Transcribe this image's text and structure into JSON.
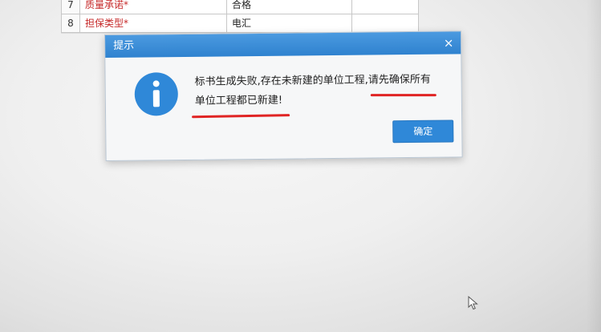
{
  "table": {
    "rows": [
      {
        "index": "7",
        "label": "质量承诺*",
        "value": "合格"
      },
      {
        "index": "8",
        "label": "担保类型*",
        "value": "电汇"
      }
    ]
  },
  "dialog": {
    "title": "提示",
    "close": "×",
    "message_line1": "标书生成失败,存在未新建的单位工程,请先确保所有",
    "message_line2": "单位工程都已新建!",
    "ok_label": "确定",
    "icon": "info-icon"
  },
  "colors": {
    "dialog_header": "#2f82cf",
    "ok_button": "#2f88d8",
    "required_label": "#c62828",
    "annotation_underline": "#e02424"
  }
}
